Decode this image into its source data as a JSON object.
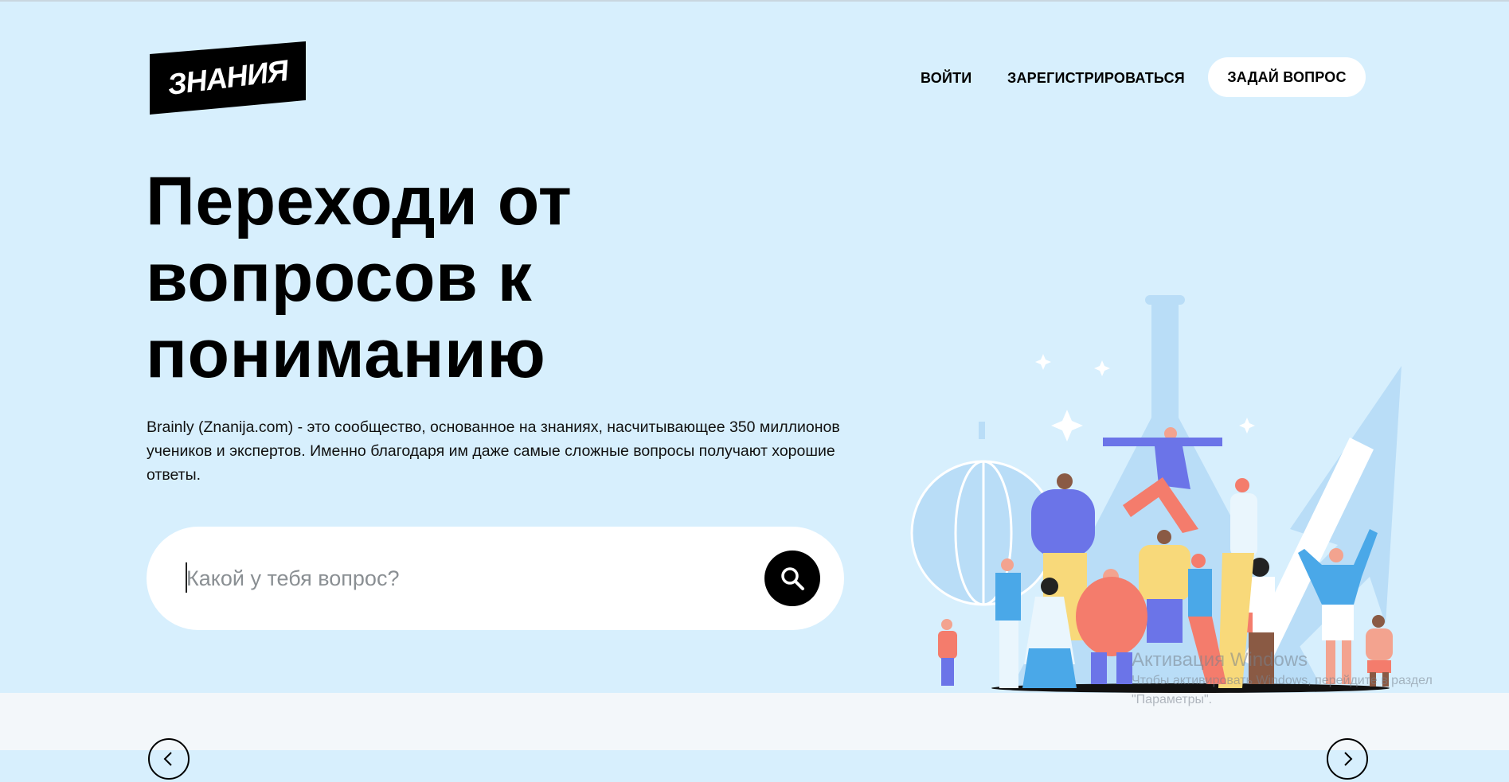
{
  "header": {
    "logo_text": "ЗНАНИЯ",
    "nav": {
      "login_label": "ВОЙТИ",
      "register_label": "ЗАРЕГИСТРИРОВАТЬСЯ",
      "ask_label": "ЗАДАЙ ВОПРОС"
    }
  },
  "hero": {
    "headline_line1": "Переходи от",
    "headline_line2": "вопросов к",
    "headline_line3": "пониманию",
    "description": "Brainly (Znanija.com) - это сообщество, основанное на знаниях, насчитывающее 350 миллионов учеников и экспертов. Именно благодаря им даже самые сложные вопросы получают хорошие ответы.",
    "search": {
      "placeholder": "Какой у тебя вопрос?",
      "value": ""
    }
  },
  "watermark": {
    "title": "Активация Windows",
    "line1": "Чтобы активировать Windows, перейдите в раздел",
    "line2": "\"Параметры\"."
  },
  "colors": {
    "hero_bg": "#d7effd",
    "bottom_bg": "#f3f7fa",
    "accent_black": "#000000",
    "button_bg": "#ffffff"
  },
  "icons": {
    "search_button": "search-icon",
    "carousel_prev": "chevron-left-icon",
    "carousel_next": "chevron-right-icon"
  }
}
